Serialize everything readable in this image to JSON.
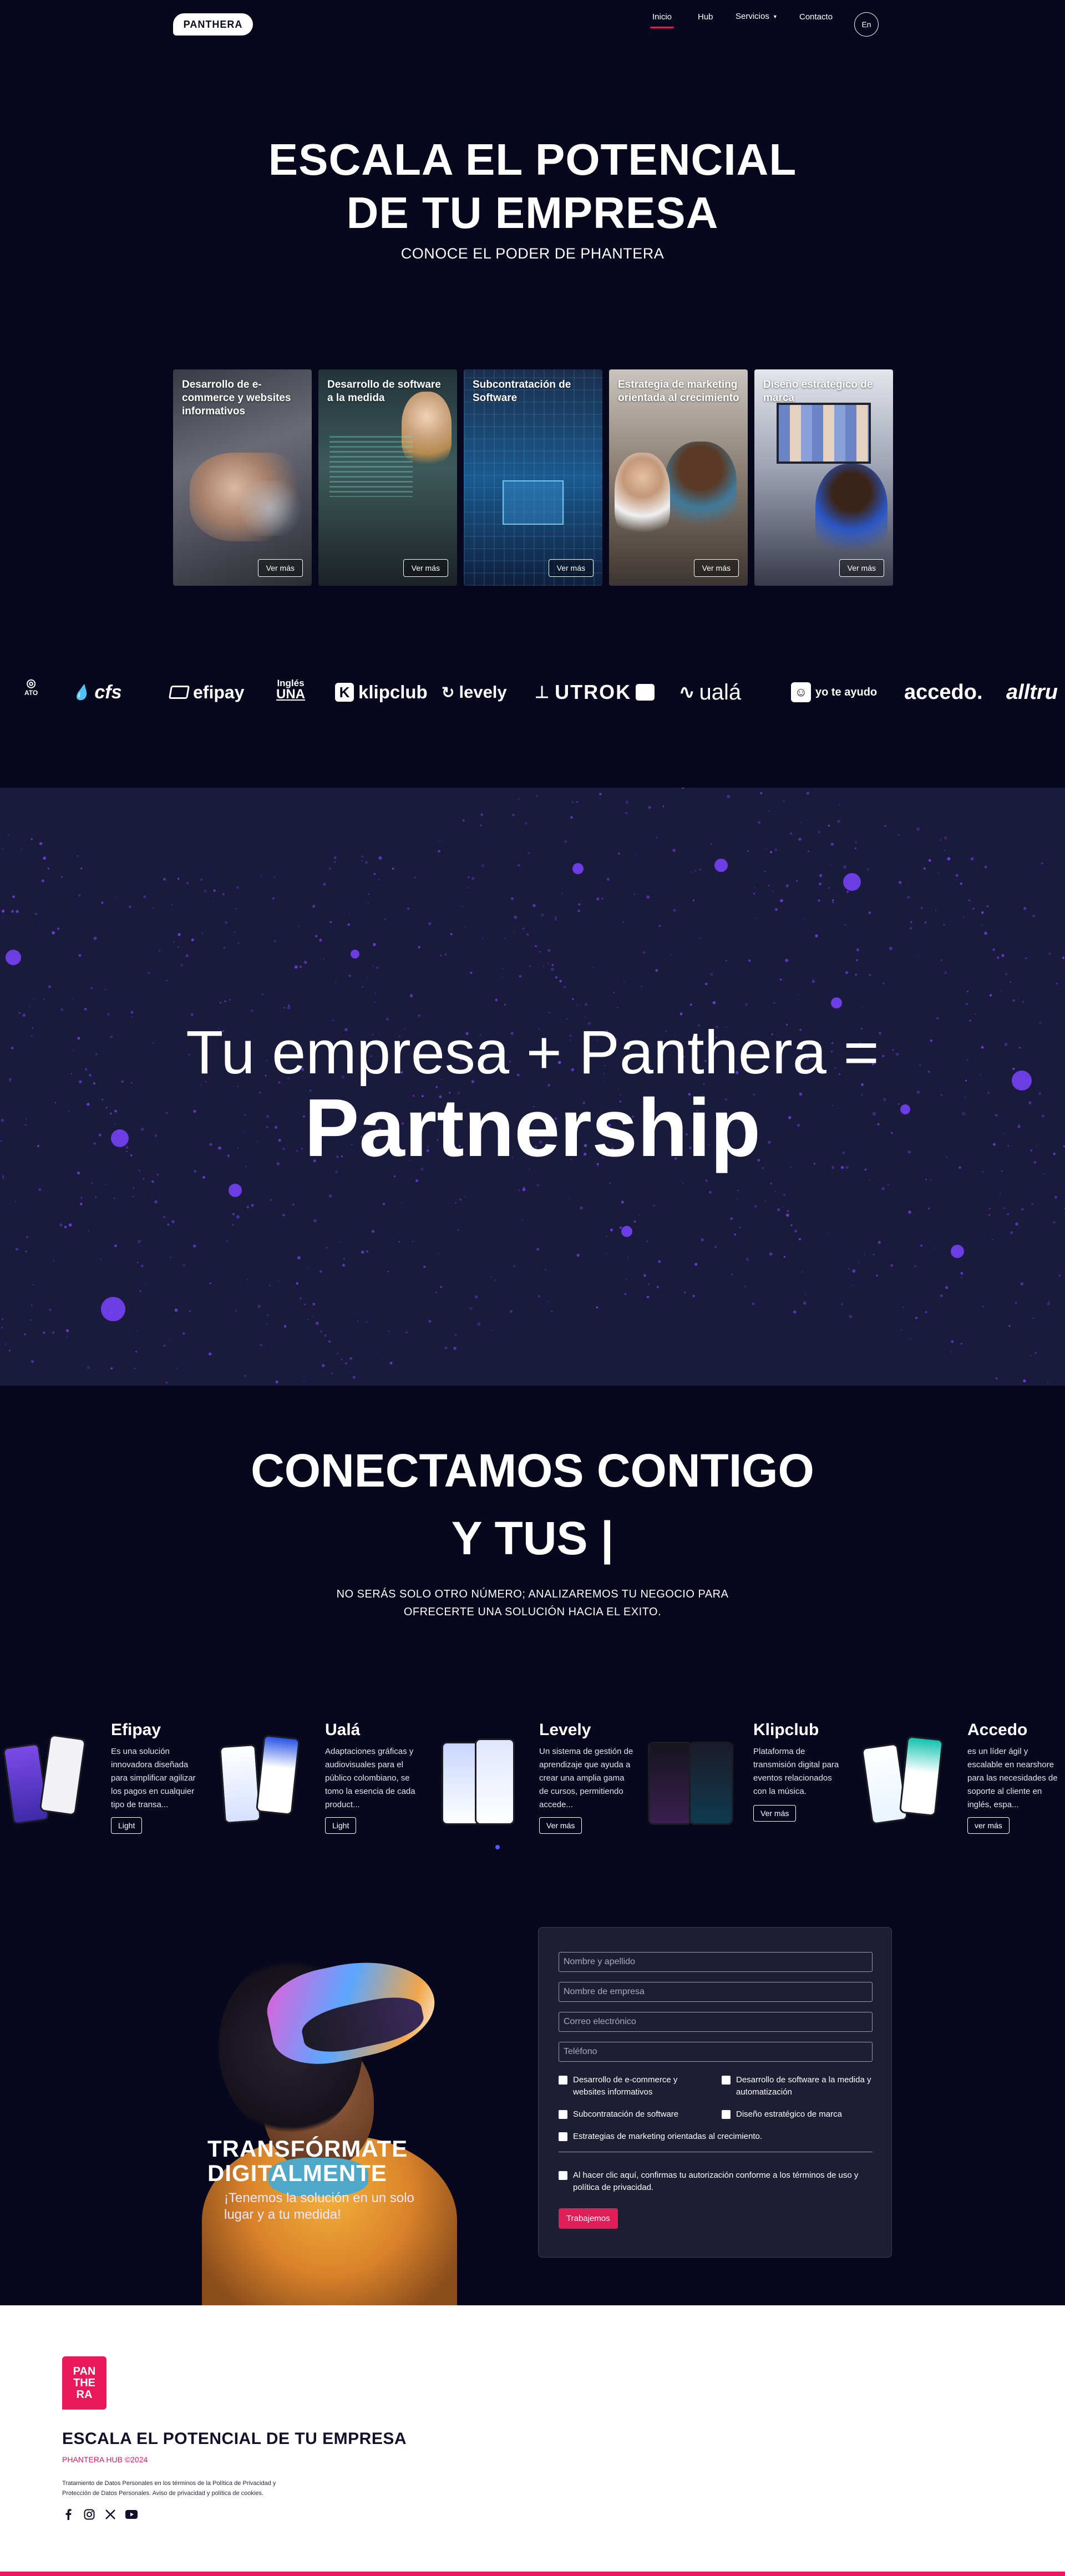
{
  "nav": {
    "logo_text": "PANTHERA",
    "links": [
      "Inicio",
      "Hub",
      "Servicios",
      "Contacto"
    ],
    "active_link": "Inicio",
    "lang_button": "En"
  },
  "hero": {
    "title_line1": "ESCALA EL POTENCIAL",
    "title_line2": "DE TU EMPRESA",
    "subtitle": "CONOCE EL PODER DE PHANTERA"
  },
  "services": [
    {
      "title": "Desarrollo de e-commerce y websites informativos",
      "button": "Ver más"
    },
    {
      "title": "Desarrollo de software a la medida",
      "button": "Ver más"
    },
    {
      "title": "Subcontratación de Software",
      "button": "Ver más"
    },
    {
      "title": "Estrategia de marketing orientada al crecimiento",
      "button": "Ver más"
    },
    {
      "title": "Diseño estratégico de marca",
      "button": "Ver más"
    }
  ],
  "clients": {
    "ato": "ATO",
    "cfs": "cfs",
    "efipay": "efipay",
    "ingles_line1": "Inglés",
    "ingles_line2": "UNA",
    "klipclub": "klipclub",
    "levely": "levely",
    "utrok": "UTROK",
    "uala": "ualá",
    "yoteayudo": "yo te ayudo",
    "accedo": "accedo.",
    "alltru": "alltru"
  },
  "partnership": {
    "line1": "Tu empresa + Panthera =",
    "line2": "Partnership"
  },
  "connect": {
    "title_line1": "CONECTAMOS CONTIGO",
    "title_line2": "Y TUS |",
    "subtitle": "NO SERÁS SOLO OTRO NÚMERO; ANALIZAREMOS TU NEGOCIO PARA OFRECERTE UNA SOLUCIÓN HACIA EL EXITO."
  },
  "apps": [
    {
      "name": "Efipay",
      "desc": "Es una solución innovadora diseñada para simplificar agilizar los pagos en cualquier tipo de transa...",
      "button": "Light"
    },
    {
      "name": "Ualá",
      "desc": "Adaptaciones gráficas y audiovisuales para el público colombiano, se tomo la esencia de cada product...",
      "button": "Light"
    },
    {
      "name": "Levely",
      "desc": "Un sistema de gestión de aprendizaje que ayuda a crear una amplia gama de cursos, permitiendo accede...",
      "button": "Ver más"
    },
    {
      "name": "Klipclub",
      "desc": "Plataforma de transmisión digital para eventos relacionados con la música.",
      "button": "Ver más"
    },
    {
      "name": "Accedo",
      "desc": "es un líder ágil y escalable en nearshore para las necesidades de soporte al cliente en inglés, espa...",
      "button": "ver más"
    }
  ],
  "transform": {
    "title_line1": "TRANSFÓRMATE",
    "title_line2": "DIGITALMENTE",
    "subtitle": "¡Tenemos la solución en un solo lugar y a tu medida!"
  },
  "form": {
    "placeholders": [
      "Nombre y apellido",
      "Nombre de empresa",
      "Correo electrónico",
      "Teléfono"
    ],
    "options": [
      "Desarrollo de e-commerce y websites informativos",
      "Desarrollo de software a la medida y automatización",
      "Subcontratación de software",
      "Diseño estratégico de marca",
      "Estrategias de marketing orientadas al crecimiento."
    ],
    "consent": "Al hacer clic aquí, confirmas tu autorización conforme a los términos de uso y política de privacidad.",
    "submit": "Trabajemos"
  },
  "footer": {
    "logo_lines": [
      "PAN",
      "THE",
      "RA"
    ],
    "title": "ESCALA EL POTENCIAL DE TU EMPRESA",
    "copyright": "PHANTERA HUB ©2024",
    "legal": "Tratamiento de Datos Personales en los términos de la Política de Privacidad y Protección de Datos Personales. Aviso de privacidad y política de cookies.",
    "social_icons": [
      "facebook-icon",
      "instagram-icon",
      "x-icon",
      "youtube-icon"
    ]
  },
  "colors": {
    "background": "#07071d",
    "partner_band": "#1a1b3c",
    "accent": "#e11d58",
    "particle": "#7a43ff"
  }
}
